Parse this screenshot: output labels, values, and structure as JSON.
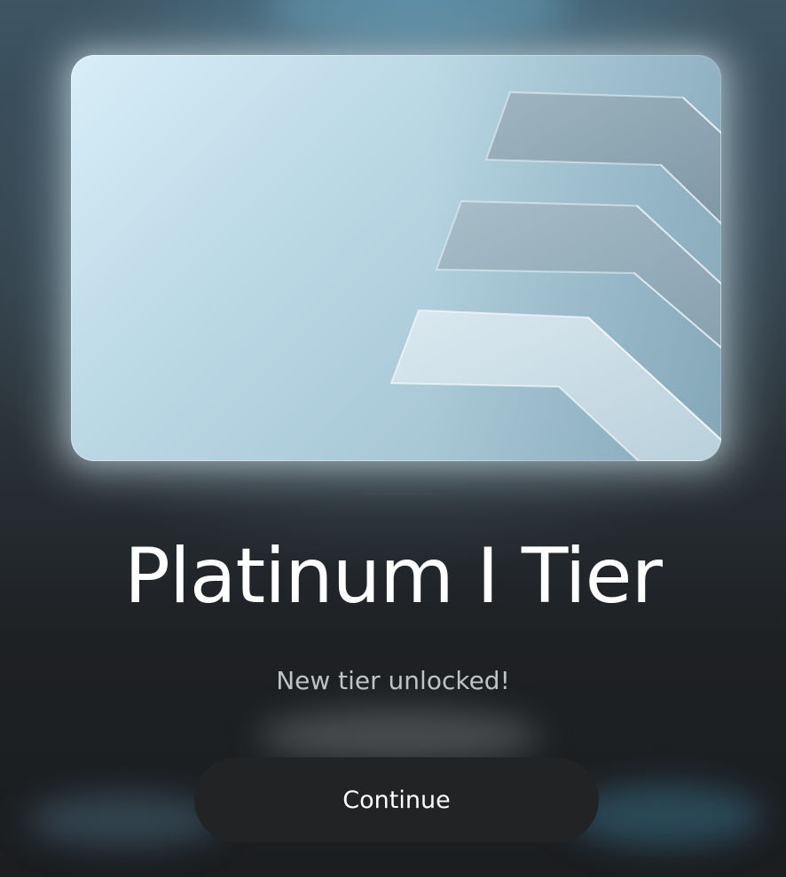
{
  "tier_card": {
    "icon": "tier-chevrons-emblem"
  },
  "title": "Platinum I Tier",
  "subtitle": "New tier unlocked!",
  "actions": {
    "continue_label": "Continue"
  },
  "colors": {
    "background": "#1c1f22",
    "card": "#bcd9e6",
    "button": "#222325",
    "title": "#ffffff",
    "subtitle": "#bfc3c6"
  }
}
